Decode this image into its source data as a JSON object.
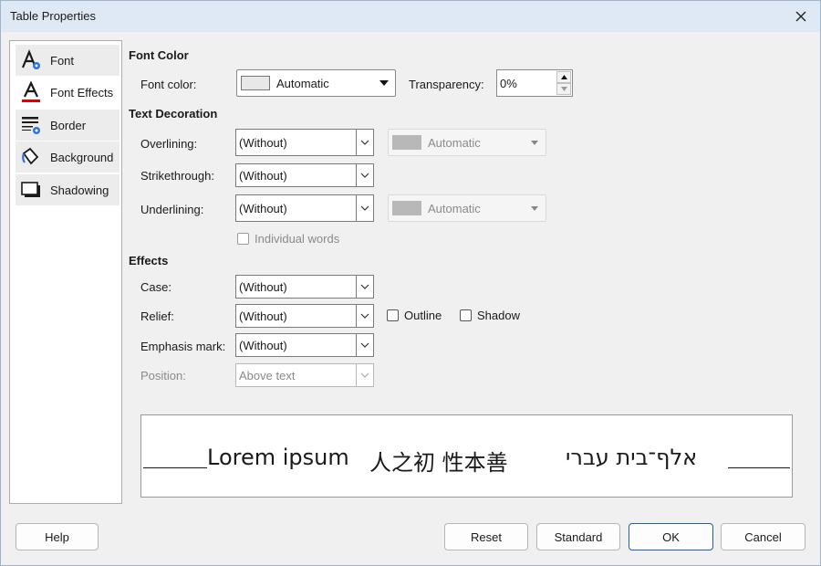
{
  "window": {
    "title": "Table Properties"
  },
  "sidebar": {
    "items": [
      {
        "label": "Font",
        "icon": "font-icon"
      },
      {
        "label": "Font Effects",
        "icon": "font-effects-icon"
      },
      {
        "label": "Border",
        "icon": "border-icon"
      },
      {
        "label": "Background",
        "icon": "background-icon"
      },
      {
        "label": "Shadowing",
        "icon": "shadowing-icon"
      }
    ],
    "active": "Font Effects"
  },
  "font_color": {
    "section": "Font Color",
    "label": "Font color:",
    "value": "Automatic",
    "transparency_label": "Transparency:",
    "transparency_value": "0%"
  },
  "text_decoration": {
    "section": "Text Decoration",
    "overlining_label": "Overlining:",
    "overlining_value": "(Without)",
    "overline_color": "Automatic",
    "strikethrough_label": "Strikethrough:",
    "strikethrough_value": "(Without)",
    "underlining_label": "Underlining:",
    "underlining_value": "(Without)",
    "underline_color": "Automatic",
    "individual_words": "Individual words"
  },
  "effects": {
    "section": "Effects",
    "case_label": "Case:",
    "case_value": "(Without)",
    "relief_label": "Relief:",
    "relief_value": "(Without)",
    "outline": "Outline",
    "shadow": "Shadow",
    "emphasis_label": "Emphasis mark:",
    "emphasis_value": "(Without)",
    "position_label": "Position:",
    "position_value": "Above text"
  },
  "preview": {
    "latin": "Lorem ipsum",
    "cjk": "人之初  性本善",
    "hebrew": "אלף־בית עברי"
  },
  "buttons": {
    "help": "Help",
    "reset": "Reset",
    "standard": "Standard",
    "ok": "OK",
    "cancel": "Cancel"
  },
  "colors": {
    "accent": "#1f5fb3",
    "font_effects_underline": "#e00000"
  }
}
